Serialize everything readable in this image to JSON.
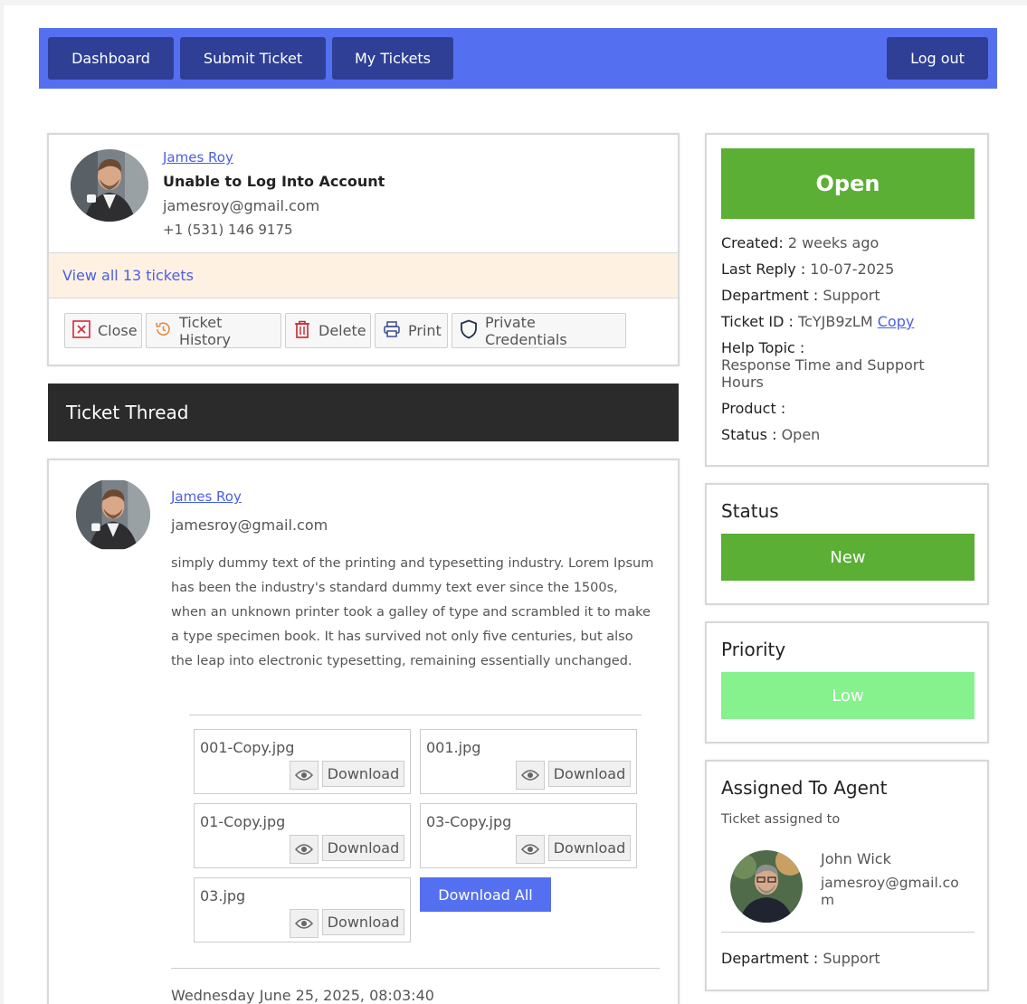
{
  "nav": {
    "dashboard": "Dashboard",
    "submit_ticket": "Submit Ticket",
    "my_tickets": "My Tickets",
    "logout": "Log out"
  },
  "ticket": {
    "requester_name": "James Roy",
    "subject": "Unable to Log Into Account",
    "email": "jamesroy@gmail.com",
    "phone": "+1 (531) 146 9175",
    "view_all": "View all 13 tickets"
  },
  "actions": {
    "close": "Close",
    "history": "Ticket History",
    "delete": "Delete",
    "print": "Print",
    "credentials": "Private Credentials"
  },
  "thread": {
    "heading": "Ticket Thread",
    "author": "James Roy",
    "email": "jamesroy@gmail.com",
    "body": "simply dummy text of the printing and typesetting industry. Lorem Ipsum has been the industry's standard dummy text ever since the 1500s, when an unknown printer took a galley of type and scrambled it to make a type specimen book. It has survived not only five centuries, but also the leap into electronic typesetting, remaining essentially unchanged.",
    "attachments": [
      "001-Copy.jpg",
      "001.jpg",
      "01-Copy.jpg",
      "03-Copy.jpg",
      "03.jpg"
    ],
    "download_label": "Download",
    "download_all": "Download All",
    "timestamp": "Wednesday June 25, 2025, 08:03:40"
  },
  "details": {
    "status_badge": "Open",
    "created_label": "Created:",
    "created_value": "2 weeks ago",
    "last_reply_label": "Last Reply :",
    "last_reply_value": "10-07-2025",
    "department_label": "Department :",
    "department_value": "Support",
    "ticket_id_label": "Ticket ID :",
    "ticket_id_value": "TcYJB9zLM",
    "copy_label": "Copy",
    "help_topic_label": "Help Topic :",
    "help_topic_value": "Response Time and Support Hours",
    "product_label": "Product :",
    "status_label": "Status :",
    "status_value": "Open"
  },
  "status_box": {
    "title": "Status",
    "value": "New"
  },
  "priority_box": {
    "title": "Priority",
    "value": "Low"
  },
  "agent_box": {
    "title": "Assigned To Agent",
    "subtitle": "Ticket assigned to",
    "name": "John Wick",
    "email": "jamesroy@gmail.com",
    "department_label": "Department :",
    "department_value": "Support"
  },
  "colors": {
    "nav_bg": "#5470f0",
    "nav_btn": "#2f3f96",
    "open_green": "#5aaf34",
    "priority_low": "#86f28e",
    "view_all_bg": "#fff1e2",
    "download_all_bg": "#5470f0"
  }
}
